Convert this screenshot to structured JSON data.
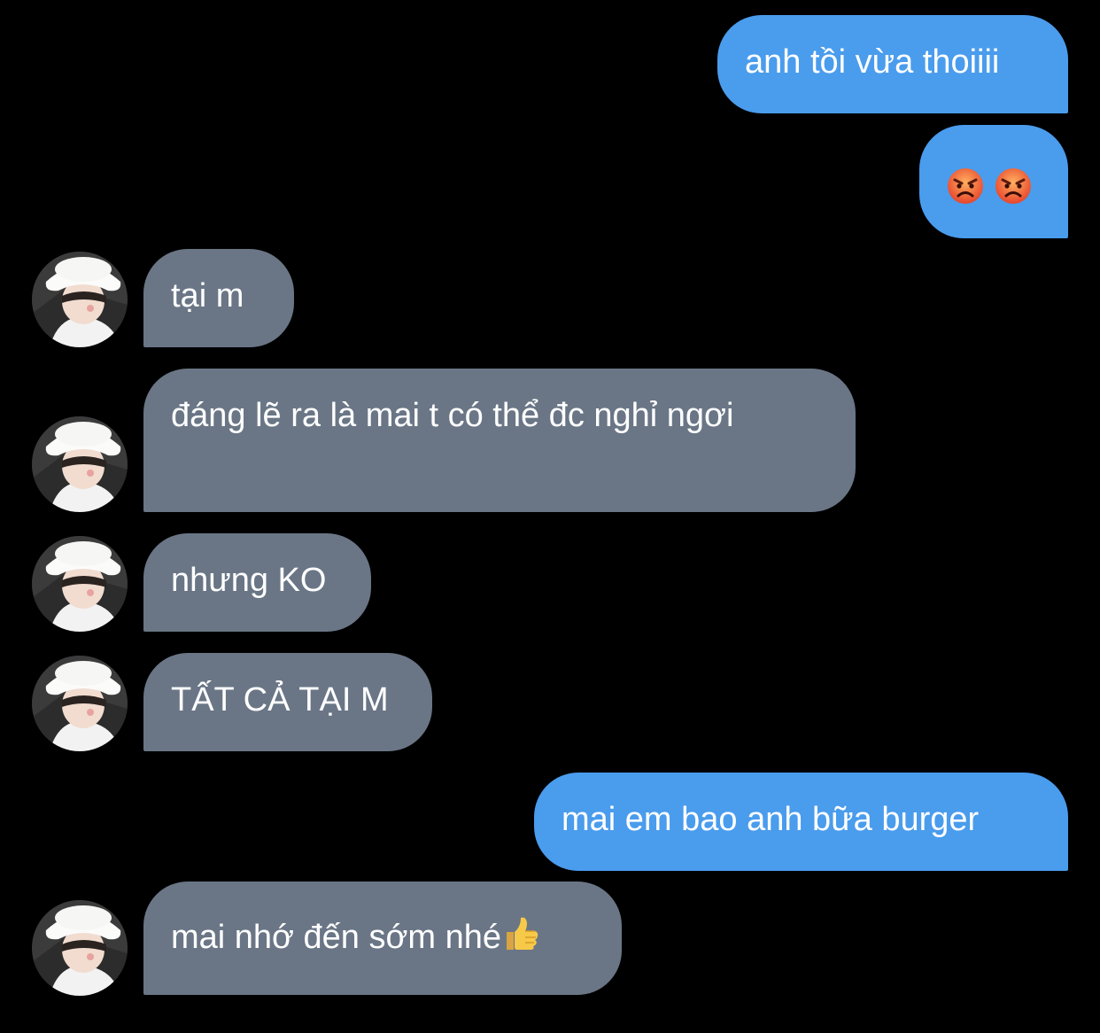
{
  "messages": [
    {
      "dir": "out",
      "text": "anh tồi vừa thoiiii"
    },
    {
      "dir": "out",
      "emoji": [
        "angry-face",
        "angry-face"
      ]
    },
    {
      "dir": "in",
      "text": "tại m"
    },
    {
      "dir": "in",
      "text": "đáng lẽ ra là mai t có thể đc nghỉ ngơi"
    },
    {
      "dir": "in",
      "text": "nhưng KO"
    },
    {
      "dir": "in",
      "text": "TẤT CẢ TẠI M"
    },
    {
      "dir": "out",
      "text": "mai em bao anh bữa burger"
    },
    {
      "dir": "in",
      "text": "mai nhớ đến sớm nhé",
      "emoji": "thumbs-up"
    }
  ],
  "colors": {
    "background": "#000000",
    "outgoing_bubble": "#4a9ced",
    "incoming_bubble": "#6a7686",
    "text": "#ffffff"
  }
}
